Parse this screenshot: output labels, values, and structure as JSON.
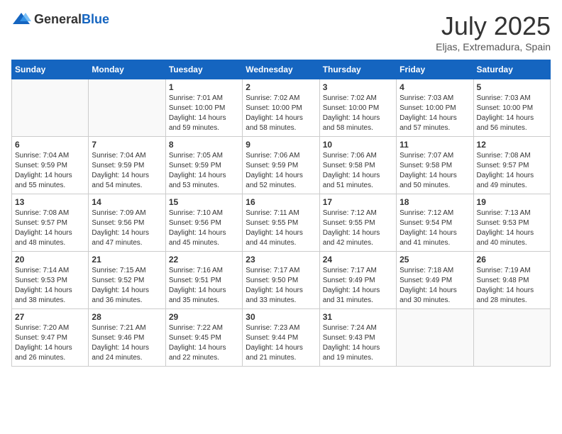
{
  "header": {
    "logo_general": "General",
    "logo_blue": "Blue",
    "month_title": "July 2025",
    "location": "Eljas, Extremadura, Spain"
  },
  "weekdays": [
    "Sunday",
    "Monday",
    "Tuesday",
    "Wednesday",
    "Thursday",
    "Friday",
    "Saturday"
  ],
  "weeks": [
    [
      {
        "day": "",
        "info": ""
      },
      {
        "day": "",
        "info": ""
      },
      {
        "day": "1",
        "info": "Sunrise: 7:01 AM\nSunset: 10:00 PM\nDaylight: 14 hours and 59 minutes."
      },
      {
        "day": "2",
        "info": "Sunrise: 7:02 AM\nSunset: 10:00 PM\nDaylight: 14 hours and 58 minutes."
      },
      {
        "day": "3",
        "info": "Sunrise: 7:02 AM\nSunset: 10:00 PM\nDaylight: 14 hours and 58 minutes."
      },
      {
        "day": "4",
        "info": "Sunrise: 7:03 AM\nSunset: 10:00 PM\nDaylight: 14 hours and 57 minutes."
      },
      {
        "day": "5",
        "info": "Sunrise: 7:03 AM\nSunset: 10:00 PM\nDaylight: 14 hours and 56 minutes."
      }
    ],
    [
      {
        "day": "6",
        "info": "Sunrise: 7:04 AM\nSunset: 9:59 PM\nDaylight: 14 hours and 55 minutes."
      },
      {
        "day": "7",
        "info": "Sunrise: 7:04 AM\nSunset: 9:59 PM\nDaylight: 14 hours and 54 minutes."
      },
      {
        "day": "8",
        "info": "Sunrise: 7:05 AM\nSunset: 9:59 PM\nDaylight: 14 hours and 53 minutes."
      },
      {
        "day": "9",
        "info": "Sunrise: 7:06 AM\nSunset: 9:59 PM\nDaylight: 14 hours and 52 minutes."
      },
      {
        "day": "10",
        "info": "Sunrise: 7:06 AM\nSunset: 9:58 PM\nDaylight: 14 hours and 51 minutes."
      },
      {
        "day": "11",
        "info": "Sunrise: 7:07 AM\nSunset: 9:58 PM\nDaylight: 14 hours and 50 minutes."
      },
      {
        "day": "12",
        "info": "Sunrise: 7:08 AM\nSunset: 9:57 PM\nDaylight: 14 hours and 49 minutes."
      }
    ],
    [
      {
        "day": "13",
        "info": "Sunrise: 7:08 AM\nSunset: 9:57 PM\nDaylight: 14 hours and 48 minutes."
      },
      {
        "day": "14",
        "info": "Sunrise: 7:09 AM\nSunset: 9:56 PM\nDaylight: 14 hours and 47 minutes."
      },
      {
        "day": "15",
        "info": "Sunrise: 7:10 AM\nSunset: 9:56 PM\nDaylight: 14 hours and 45 minutes."
      },
      {
        "day": "16",
        "info": "Sunrise: 7:11 AM\nSunset: 9:55 PM\nDaylight: 14 hours and 44 minutes."
      },
      {
        "day": "17",
        "info": "Sunrise: 7:12 AM\nSunset: 9:55 PM\nDaylight: 14 hours and 42 minutes."
      },
      {
        "day": "18",
        "info": "Sunrise: 7:12 AM\nSunset: 9:54 PM\nDaylight: 14 hours and 41 minutes."
      },
      {
        "day": "19",
        "info": "Sunrise: 7:13 AM\nSunset: 9:53 PM\nDaylight: 14 hours and 40 minutes."
      }
    ],
    [
      {
        "day": "20",
        "info": "Sunrise: 7:14 AM\nSunset: 9:53 PM\nDaylight: 14 hours and 38 minutes."
      },
      {
        "day": "21",
        "info": "Sunrise: 7:15 AM\nSunset: 9:52 PM\nDaylight: 14 hours and 36 minutes."
      },
      {
        "day": "22",
        "info": "Sunrise: 7:16 AM\nSunset: 9:51 PM\nDaylight: 14 hours and 35 minutes."
      },
      {
        "day": "23",
        "info": "Sunrise: 7:17 AM\nSunset: 9:50 PM\nDaylight: 14 hours and 33 minutes."
      },
      {
        "day": "24",
        "info": "Sunrise: 7:17 AM\nSunset: 9:49 PM\nDaylight: 14 hours and 31 minutes."
      },
      {
        "day": "25",
        "info": "Sunrise: 7:18 AM\nSunset: 9:49 PM\nDaylight: 14 hours and 30 minutes."
      },
      {
        "day": "26",
        "info": "Sunrise: 7:19 AM\nSunset: 9:48 PM\nDaylight: 14 hours and 28 minutes."
      }
    ],
    [
      {
        "day": "27",
        "info": "Sunrise: 7:20 AM\nSunset: 9:47 PM\nDaylight: 14 hours and 26 minutes."
      },
      {
        "day": "28",
        "info": "Sunrise: 7:21 AM\nSunset: 9:46 PM\nDaylight: 14 hours and 24 minutes."
      },
      {
        "day": "29",
        "info": "Sunrise: 7:22 AM\nSunset: 9:45 PM\nDaylight: 14 hours and 22 minutes."
      },
      {
        "day": "30",
        "info": "Sunrise: 7:23 AM\nSunset: 9:44 PM\nDaylight: 14 hours and 21 minutes."
      },
      {
        "day": "31",
        "info": "Sunrise: 7:24 AM\nSunset: 9:43 PM\nDaylight: 14 hours and 19 minutes."
      },
      {
        "day": "",
        "info": ""
      },
      {
        "day": "",
        "info": ""
      }
    ]
  ]
}
